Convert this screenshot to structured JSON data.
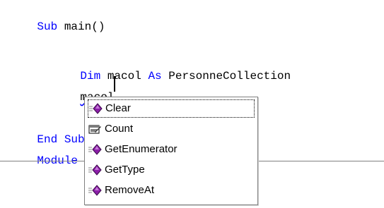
{
  "code": {
    "line1": {
      "kw": "Sub",
      "rest": " main()"
    },
    "line2": {
      "kw1": "Dim",
      "mid": " macol ",
      "kw2": "As",
      "rest": " PersonneCollection"
    },
    "line3": {
      "obj": "macol",
      "dot": "."
    },
    "line4": {
      "kw": "End Sub"
    },
    "line5": {
      "kw": "Module"
    }
  },
  "intellisense": {
    "items": [
      {
        "label": "Clear",
        "icon": "method-icon",
        "selected": true
      },
      {
        "label": "Count",
        "icon": "property-icon",
        "selected": false
      },
      {
        "label": "GetEnumerator",
        "icon": "method-icon",
        "selected": false
      },
      {
        "label": "GetType",
        "icon": "method-icon",
        "selected": false
      },
      {
        "label": "RemoveAt",
        "icon": "method-icon",
        "selected": false
      }
    ]
  },
  "colors": {
    "keyword": "#0000ff",
    "method_icon": "#8b1fa8",
    "selection_border": "#000000"
  }
}
